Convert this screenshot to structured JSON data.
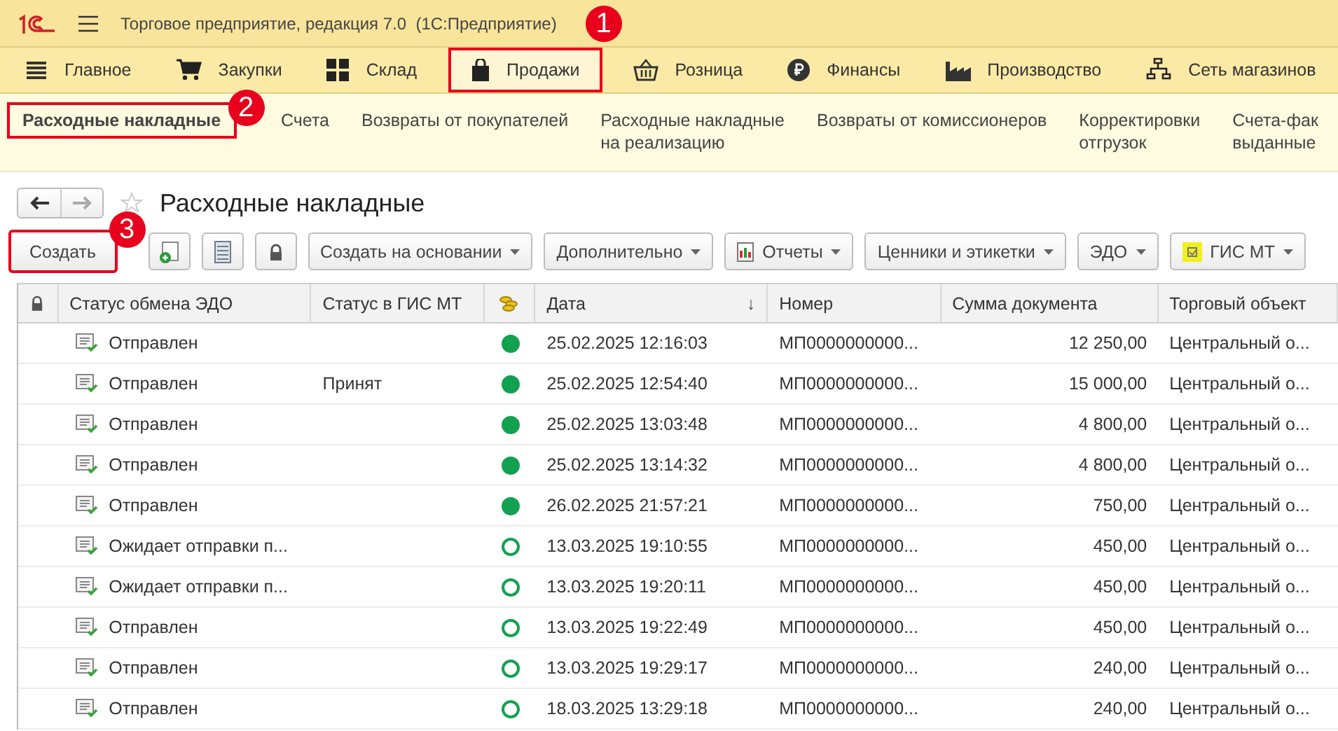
{
  "window": {
    "title": "Торговое предприятие, редакция 7.0  (1С:Предприятие)"
  },
  "sections": [
    {
      "label": "Главное",
      "selected": false
    },
    {
      "label": "Закупки",
      "selected": false
    },
    {
      "label": "Склад",
      "selected": false
    },
    {
      "label": "Продажи",
      "selected": true,
      "callout": "1"
    },
    {
      "label": "Розница",
      "selected": false
    },
    {
      "label": "Финансы",
      "selected": false
    },
    {
      "label": "Производство",
      "selected": false
    },
    {
      "label": "Сеть магазинов",
      "selected": false
    }
  ],
  "subsections": [
    {
      "lines": [
        "Расходные накладные"
      ],
      "selected": true,
      "callout": "2"
    },
    {
      "lines": [
        "Счета"
      ],
      "selected": false
    },
    {
      "lines": [
        "Возвраты от покупателей"
      ],
      "selected": false
    },
    {
      "lines": [
        "Расходные накладные",
        "на реализацию"
      ],
      "selected": false
    },
    {
      "lines": [
        "Возвраты от комиссионеров"
      ],
      "selected": false
    },
    {
      "lines": [
        "Корректировки",
        "отгрузок"
      ],
      "selected": false
    },
    {
      "lines": [
        "Счета-фак",
        "выданные"
      ],
      "selected": false
    }
  ],
  "form": {
    "title": "Расходные накладные"
  },
  "toolbar": [
    {
      "kind": "text",
      "label": "Создать",
      "callout": "3"
    },
    {
      "kind": "copy"
    },
    {
      "kind": "list"
    },
    {
      "kind": "lock"
    },
    {
      "kind": "menu",
      "label": "Создать на основании"
    },
    {
      "kind": "menu",
      "label": "Дополнительно"
    },
    {
      "kind": "menu",
      "label": "Отчеты"
    },
    {
      "kind": "menu",
      "label": "Ценники и этикетки"
    },
    {
      "kind": "menu",
      "label": "ЭДО"
    },
    {
      "kind": "menu",
      "label": "ГИС МТ"
    }
  ],
  "table": {
    "columns": [
      {
        "kind": "lock"
      },
      {
        "label": "Статус обмена ЭДО"
      },
      {
        "label": "Статус в ГИС МТ"
      },
      {
        "kind": "coins"
      },
      {
        "label": "Дата",
        "sort": "↓"
      },
      {
        "label": "Номер"
      },
      {
        "label": "Сумма документа"
      },
      {
        "label": "Торговый объект"
      }
    ],
    "rows": [
      {
        "edo": "Отправлен",
        "gis": "",
        "paid": true,
        "date": "25.02.2025 12:16:03",
        "number": "МП0000000000...",
        "sum": "12 250,00",
        "object": "Центральный о..."
      },
      {
        "edo": "Отправлен",
        "gis": "Принят",
        "paid": true,
        "date": "25.02.2025 12:54:40",
        "number": "МП0000000000...",
        "sum": "15 000,00",
        "object": "Центральный о..."
      },
      {
        "edo": "Отправлен",
        "gis": "",
        "paid": true,
        "date": "25.02.2025 13:03:48",
        "number": "МП0000000000...",
        "sum": "4 800,00",
        "object": "Центральный о..."
      },
      {
        "edo": "Отправлен",
        "gis": "",
        "paid": true,
        "date": "25.02.2025 13:14:32",
        "number": "МП0000000000...",
        "sum": "4 800,00",
        "object": "Центральный о..."
      },
      {
        "edo": "Отправлен",
        "gis": "",
        "paid": true,
        "date": "26.02.2025 21:57:21",
        "number": "МП0000000000...",
        "sum": "750,00",
        "object": "Центральный о..."
      },
      {
        "edo": "Ожидает отправки п...",
        "gis": "",
        "paid": false,
        "date": "13.03.2025 19:10:55",
        "number": "МП0000000000...",
        "sum": "450,00",
        "object": "Центральный о..."
      },
      {
        "edo": "Ожидает отправки п...",
        "gis": "",
        "paid": false,
        "date": "13.03.2025 19:20:11",
        "number": "МП0000000000...",
        "sum": "450,00",
        "object": "Центральный о..."
      },
      {
        "edo": "Отправлен",
        "gis": "",
        "paid": false,
        "date": "13.03.2025 19:22:49",
        "number": "МП0000000000...",
        "sum": "450,00",
        "object": "Центральный о..."
      },
      {
        "edo": "Отправлен",
        "gis": "",
        "paid": false,
        "date": "13.03.2025 19:29:17",
        "number": "МП0000000000...",
        "sum": "240,00",
        "object": "Центральный о..."
      },
      {
        "edo": "Отправлен",
        "gis": "",
        "paid": false,
        "date": "18.03.2025 13:29:18",
        "number": "МП0000000000...",
        "sum": "240,00",
        "object": "Центральный о..."
      }
    ]
  }
}
